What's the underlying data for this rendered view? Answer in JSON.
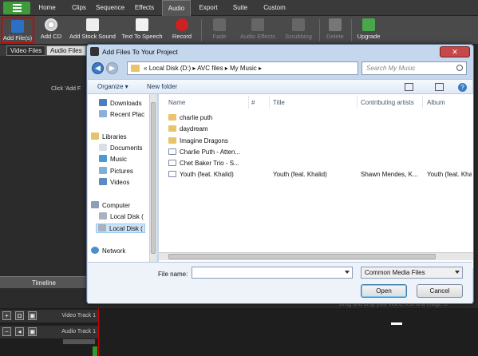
{
  "menu": {
    "tabs": [
      {
        "label": "Home"
      },
      {
        "label": "Clips"
      },
      {
        "label": "Sequence"
      },
      {
        "label": "Effects"
      },
      {
        "label": "Audio",
        "active": true
      },
      {
        "label": "Export"
      },
      {
        "label": "Suite"
      },
      {
        "label": "Custom"
      }
    ]
  },
  "ribbon": {
    "tools": [
      {
        "label": "Add File(s)",
        "icon": "add-file-icon",
        "selected": true
      },
      {
        "label": "Add CD",
        "icon": "cd-icon"
      },
      {
        "label": "Add Stock Sound",
        "icon": "stock-sound-icon"
      },
      {
        "label": "Text To Speech",
        "icon": "text-to-speech-icon"
      },
      {
        "label": "Record",
        "icon": "record-icon"
      },
      {
        "label": "Fade",
        "icon": "fade-icon",
        "disabled": true
      },
      {
        "label": "Audio Effects",
        "icon": "audio-effects-icon",
        "disabled": true
      },
      {
        "label": "Scrubbing",
        "icon": "scrubbing-icon",
        "disabled": true
      },
      {
        "label": "Delete",
        "icon": "delete-icon",
        "disabled": true
      },
      {
        "label": "Upgrade",
        "icon": "upgrade-icon"
      }
    ]
  },
  "left_panel": {
    "tabs": [
      "Video Files",
      "Audio Files"
    ],
    "hint": "Click 'Add F",
    "timeline_tab": "Timeline",
    "drag_hint": "Drag and drop your video, text and image cl"
  },
  "timeline": {
    "tracks": [
      "Video Track 1",
      "Audio Track 1"
    ]
  },
  "dialog": {
    "title": "Add Files To Your Project",
    "close_label": "✕",
    "address": {
      "parts": [
        "«",
        "Local Disk (D:)",
        "AVC files",
        "My Music"
      ],
      "separator": "▸"
    },
    "search_placeholder": "Search My Music",
    "commands": {
      "organize": "Organize ▾",
      "new_folder": "New folder"
    },
    "nav": {
      "items": [
        {
          "label": "Downloads"
        },
        {
          "label": "Recent Plac"
        },
        {
          "label": "Libraries"
        },
        {
          "label": "Documents"
        },
        {
          "label": "Music"
        },
        {
          "label": "Pictures"
        },
        {
          "label": "Videos"
        },
        {
          "label": "Computer"
        },
        {
          "label": "Local Disk ("
        },
        {
          "label": "Local Disk (",
          "selected": true
        },
        {
          "label": "Network"
        }
      ]
    },
    "columns": [
      "Name",
      "#",
      "Title",
      "Contributing artists",
      "Album"
    ],
    "files": [
      {
        "name": "charlie puth",
        "type": "folder",
        "title": "",
        "artists": "",
        "album": ""
      },
      {
        "name": "daydream",
        "type": "folder",
        "title": "",
        "artists": "",
        "album": ""
      },
      {
        "name": "Imagine Dragons",
        "type": "folder",
        "title": "",
        "artists": "",
        "album": ""
      },
      {
        "name": "Charlie Puth - Atten...",
        "type": "media",
        "title": "",
        "artists": "",
        "album": ""
      },
      {
        "name": "Chet Baker Trio - S...",
        "type": "media",
        "title": "",
        "artists": "",
        "album": ""
      },
      {
        "name": "Youth (feat. Khalid)",
        "type": "media",
        "title": "Youth (feat. Khalid)",
        "artists": "Shawn Mendes, K...",
        "album": "Youth (feat. Khalid)"
      }
    ],
    "file_name_label": "File name:",
    "file_name_value": "",
    "filter_value": "Common Media Files",
    "open_label": "Open",
    "cancel_label": "Cancel"
  },
  "colors": {
    "menu_accent": "#3e9a3a",
    "dialog_frame": "#c4d7ed",
    "record_red": "#cc2222",
    "playhead": "#cc0000"
  }
}
